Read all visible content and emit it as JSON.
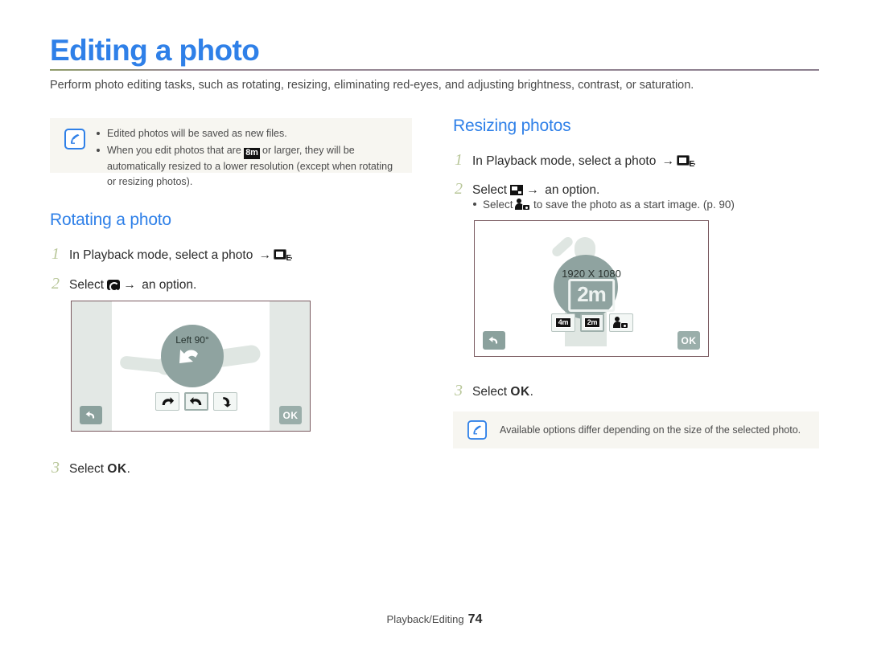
{
  "document": {
    "title": "Editing a photo",
    "intro": "Perform photo editing tasks, such as rotating, resizing, eliminating red-eyes, and adjusting brightness, contrast, or saturation.",
    "accent_color": "#2f80e8",
    "rule_color": "#8c7f8e",
    "step_number_color": "#b9c79a"
  },
  "top_note": {
    "icon": "note-pencil-icon",
    "bullets": [
      {
        "before": "Edited photos will be saved as new files.",
        "icon": "",
        "after": ""
      },
      {
        "before": "When you edit photos that are ",
        "icon": "8m",
        "after": " or larger, they will be automatically resized to a lower resolution (except when rotating or resizing photos)."
      }
    ]
  },
  "rotating": {
    "heading": "Rotating a photo",
    "step1": {
      "num": "1",
      "text_before": "In Playback mode, select a photo ",
      "arrow": "→",
      "icon": "edit-mode-icon",
      "text_after": "."
    },
    "step2": {
      "num": "2",
      "text_before": "Select ",
      "icon": "rotate-icon",
      "arrow": "→",
      "text_after": " an option."
    },
    "step3": {
      "num": "3",
      "text_before": "Select ",
      "ok": "OK",
      "text_after": "."
    },
    "screen": {
      "overlay_label": "Left 90°",
      "back_button": "back-arrow",
      "ok_button": "OK",
      "options": [
        {
          "name": "rotate-right",
          "selected": false
        },
        {
          "name": "rotate-left",
          "selected": true
        },
        {
          "name": "flip-rotate",
          "selected": false
        }
      ]
    }
  },
  "resizing": {
    "heading": "Resizing photos",
    "step1": {
      "num": "1",
      "text_before": "In Playback mode, select a photo ",
      "arrow": "→",
      "icon": "edit-mode-icon",
      "text_after": "."
    },
    "step2": {
      "num": "2",
      "text_before": "Select ",
      "icon": "resize-icon",
      "arrow": "→",
      "text_after": " an option."
    },
    "step2_sub": {
      "text_before": "Select ",
      "icon": "start-image-icon",
      "text_after": " to save the photo as a start image. (p. 90)"
    },
    "step3": {
      "num": "3",
      "text_before": "Select ",
      "ok": "OK",
      "text_after": "."
    },
    "screen": {
      "resolution_label": "1920 X 1080",
      "selected_resolution": "2m",
      "back_button": "back-arrow",
      "ok_button": "OK",
      "options": [
        {
          "label": "4m",
          "selected": false
        },
        {
          "label": "2m",
          "selected": true
        },
        {
          "label": "start-image-icon",
          "selected": false
        }
      ]
    },
    "note": {
      "icon": "note-pencil-icon",
      "text": "Available options differ depending on the size of the selected photo."
    }
  },
  "footer": {
    "section": "Playback/Editing",
    "page": "74"
  }
}
